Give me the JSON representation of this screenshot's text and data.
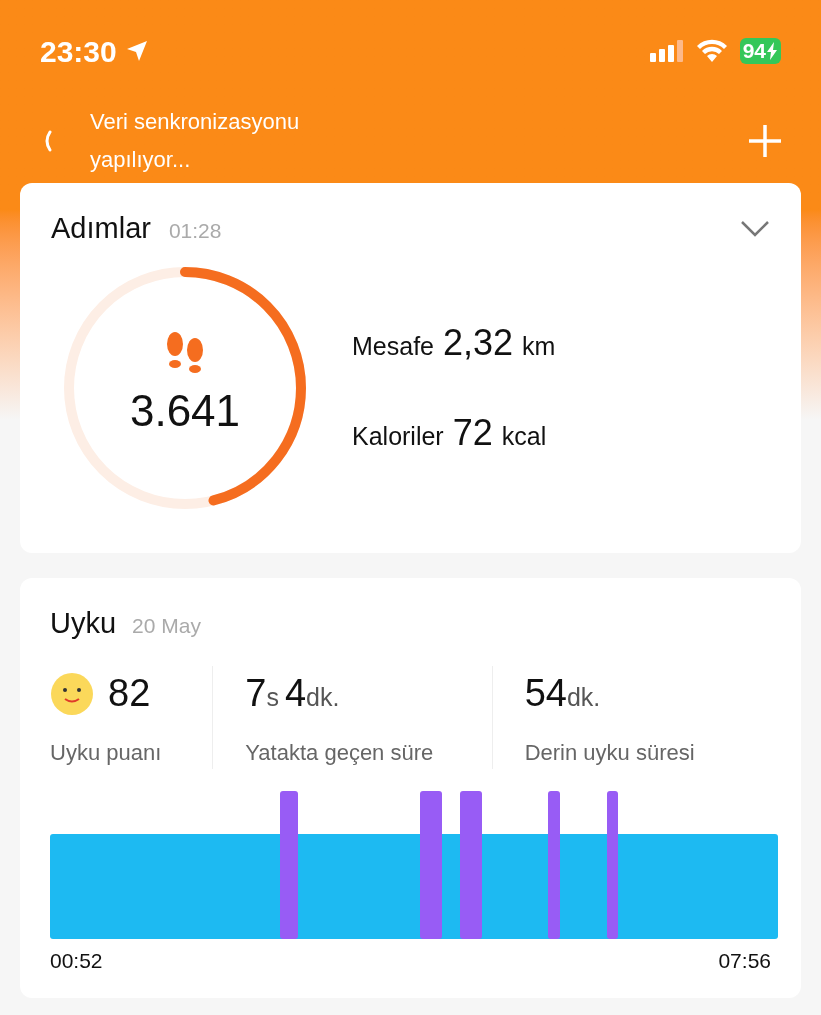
{
  "status_bar": {
    "time": "23:30",
    "battery": "94"
  },
  "header": {
    "sync_text": "Veri senkronizasyonu yapılıyor..."
  },
  "steps_card": {
    "title": "Adımlar",
    "time": "01:28",
    "steps": "3.641",
    "metrics": [
      {
        "label": "Mesafe",
        "value": "2,32",
        "unit": "km"
      },
      {
        "label": "Kaloriler",
        "value": "72",
        "unit": "kcal"
      }
    ]
  },
  "sleep_card": {
    "title": "Uyku",
    "date": "20 May",
    "stats": [
      {
        "kind": "score",
        "parts": [
          {
            "value": "82"
          }
        ],
        "label": "Uyku puanı"
      },
      {
        "kind": "duration",
        "parts": [
          {
            "value": "7",
            "unit": "s"
          },
          {
            "value": "4",
            "unit": "dk."
          }
        ],
        "label": "Yatakta geçen süre"
      },
      {
        "kind": "duration",
        "parts": [
          {
            "value": "54",
            "unit": "dk."
          }
        ],
        "label": "Derin uyku süresi"
      }
    ],
    "start_time": "00:52",
    "end_time": "07:56"
  }
}
